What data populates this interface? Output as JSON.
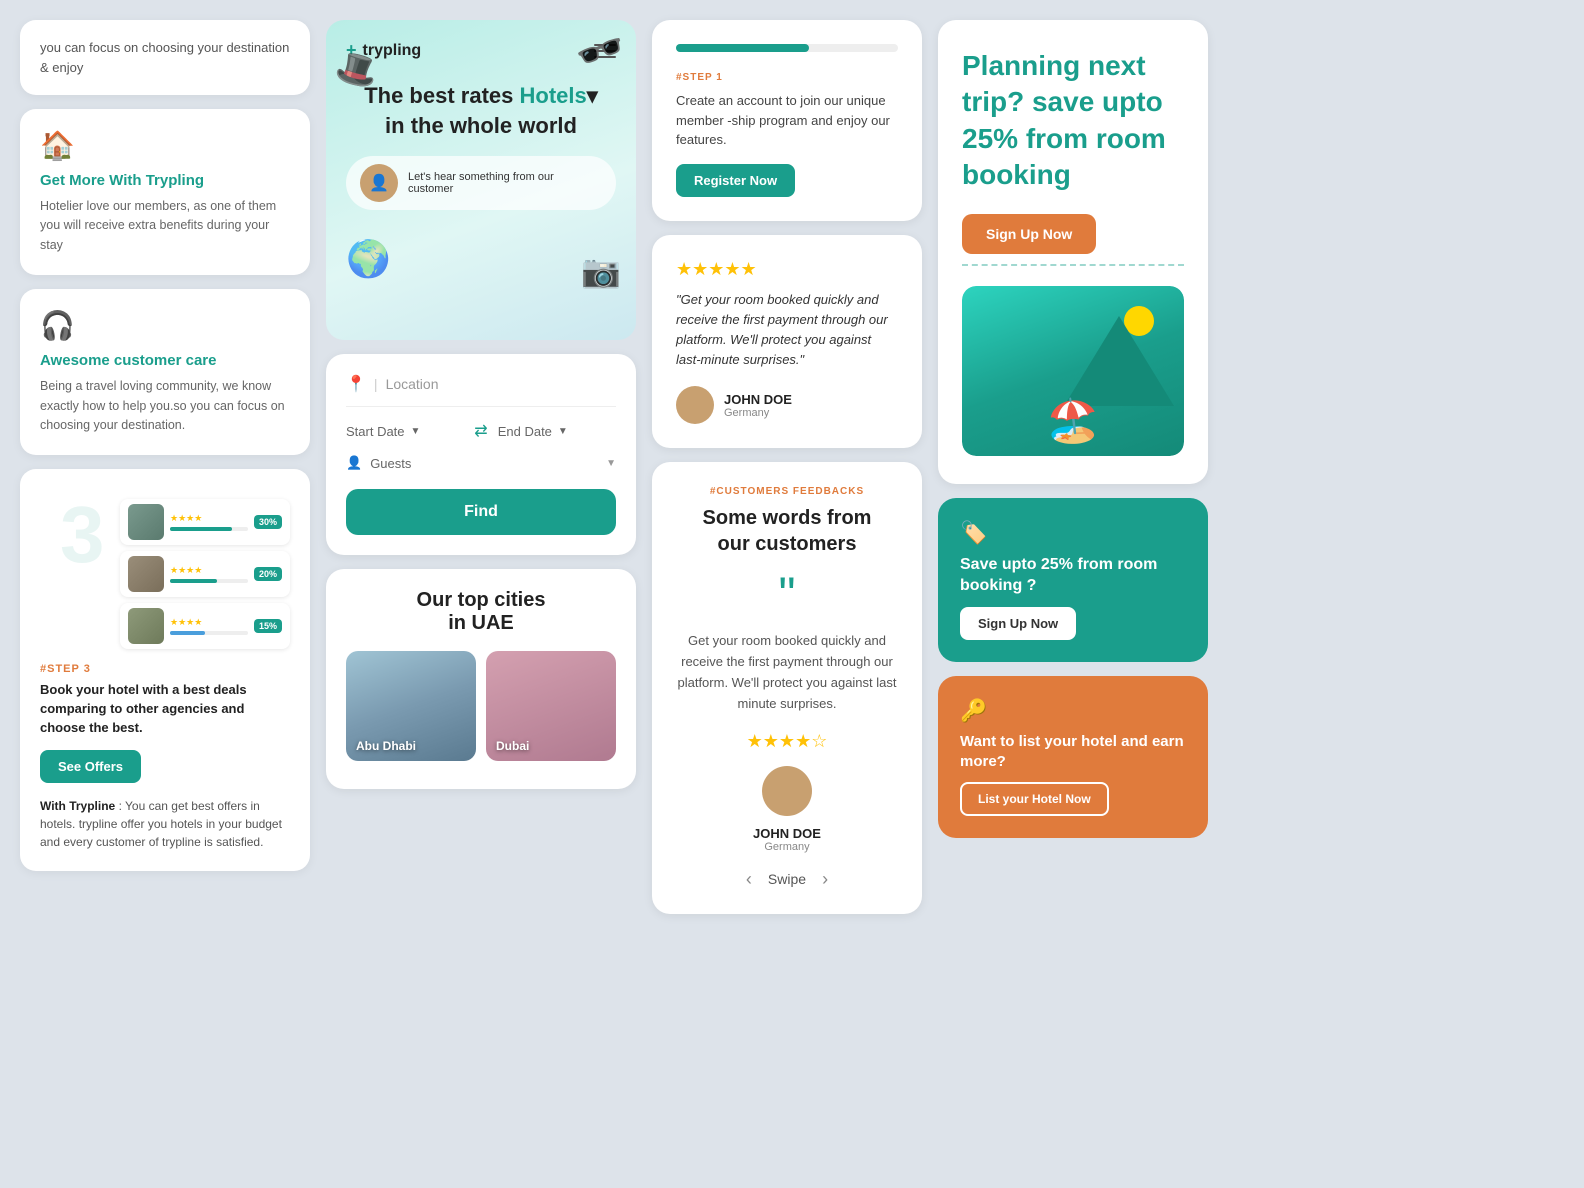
{
  "brand": {
    "name": "trypling",
    "logo_plus": "+"
  },
  "col1": {
    "intro_text": "you can focus on choosing your destination & enjoy",
    "feature1": {
      "icon": "🏠",
      "title": "Get More With Trypling",
      "desc": "Hotelier love our members, as one of them you will receive extra benefits during your stay"
    },
    "feature2": {
      "icon": "🎧",
      "title": "Awesome customer care",
      "desc": "Being a travel loving community, we know exactly how to help you.so you can focus on choosing your destination."
    },
    "step3": {
      "number": "3",
      "label": "#STEP 3",
      "desc": "Book your hotel with a best deals comparing to other agencies and choose the best.",
      "btn": "See Offers",
      "footnote_brand": "With Trypline",
      "footnote": " : You can get best offers in hotels. trypline offer you hotels in your budget and every customer of trypline is satisfied.",
      "hotels": [
        {
          "stars": "★★★★",
          "bar": 80,
          "badge": "30%"
        },
        {
          "stars": "★★★★",
          "bar": 60,
          "badge": "20%"
        },
        {
          "stars": "★★★★",
          "bar": 45,
          "badge": "15%"
        }
      ]
    }
  },
  "col2": {
    "hero": {
      "headline_part1": "The best rates",
      "headline_accent": "Hotels",
      "headline_part2": "in the whole world",
      "testimonial_text": "Let's hear something from our customer"
    },
    "search": {
      "location_placeholder": "Location",
      "start_date": "Start Date",
      "end_date": "End Date",
      "guests": "Guests",
      "find_btn": "Find"
    },
    "cities": {
      "title_line1": "Our top cities",
      "title_line2": "in UAE",
      "city1": "Abu Dhabi",
      "city2": "Dubai"
    }
  },
  "col3": {
    "step1": {
      "label": "#STEP 1",
      "desc": "Create an account to join our unique member -ship program and enjoy our features.",
      "btn": "Register Now"
    },
    "review": {
      "stars": "★★★★★",
      "quote": "\"Get your room booked quickly and receive the first payment through our platform. We'll protect you against last-minute surprises.\"",
      "author_name": "JOHN DOE",
      "author_country": "Germany"
    },
    "feedback": {
      "tag": "#CUSTOMERS FEEDBACKS",
      "title_line1": "Some words from",
      "title_line2": "our customers",
      "quote_text": "Get your room booked quickly and receive the first payment through our platform. We'll protect you against last minute surprises.",
      "stars": "★★★★☆",
      "author_name": "JOHN DOE",
      "author_country": "Germany",
      "swipe_label": "Swipe"
    }
  },
  "col4": {
    "promo": {
      "title": "Planning next trip? save upto 25% from room booking",
      "btn": "Sign Up Now"
    },
    "save": {
      "icon": "🏷️",
      "text": "Save upto 25% from room booking ?",
      "btn": "Sign Up Now"
    },
    "list": {
      "icon": "🔑",
      "text": "Want to list your hotel and earn more?",
      "btn": "List your Hotel Now"
    }
  }
}
